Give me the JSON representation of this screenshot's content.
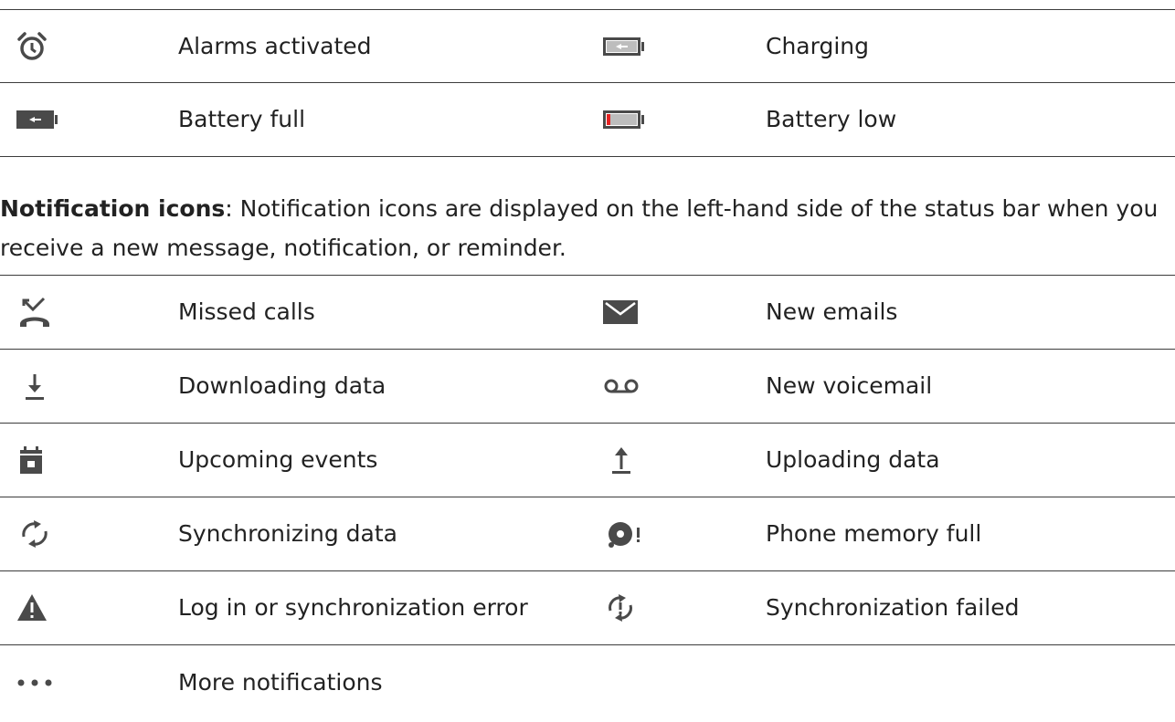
{
  "status_table": {
    "rows": [
      {
        "left": {
          "icon": "alarm-clock-icon",
          "label": "Alarms activated"
        },
        "right": {
          "icon": "battery-charging-icon",
          "label": "Charging"
        }
      },
      {
        "left": {
          "icon": "battery-full-icon",
          "label": "Battery full"
        },
        "right": {
          "icon": "battery-low-icon",
          "label": "Battery low"
        }
      }
    ]
  },
  "notification_section": {
    "heading": "Notification icons",
    "text": ": Notification icons are displayed on the left-hand side of the status bar when you receive a new message, notification, or reminder."
  },
  "notification_table": {
    "rows": [
      {
        "left": {
          "icon": "missed-call-icon",
          "label": "Missed calls"
        },
        "right": {
          "icon": "envelope-icon",
          "label": "New emails"
        }
      },
      {
        "left": {
          "icon": "download-icon",
          "label": "Downloading data"
        },
        "right": {
          "icon": "voicemail-icon",
          "label": "New voicemail"
        }
      },
      {
        "left": {
          "icon": "calendar-icon",
          "label": "Upcoming events"
        },
        "right": {
          "icon": "upload-icon",
          "label": "Uploading data"
        }
      },
      {
        "left": {
          "icon": "sync-icon",
          "label": "Synchronizing data"
        },
        "right": {
          "icon": "memory-full-icon",
          "label": "Phone memory full"
        }
      },
      {
        "left": {
          "icon": "warning-icon",
          "label": "Log in or synchronization error"
        },
        "right": {
          "icon": "sync-failed-icon",
          "label": "Synchronization failed"
        }
      },
      {
        "left": {
          "icon": "more-dots-icon",
          "label": "More notifications"
        },
        "right": {
          "icon": "",
          "label": ""
        }
      }
    ]
  },
  "colors": {
    "text": "#222222",
    "rule": "#3c3c3c",
    "icon": "#4a4a4a",
    "battery_low": "#e52222"
  }
}
